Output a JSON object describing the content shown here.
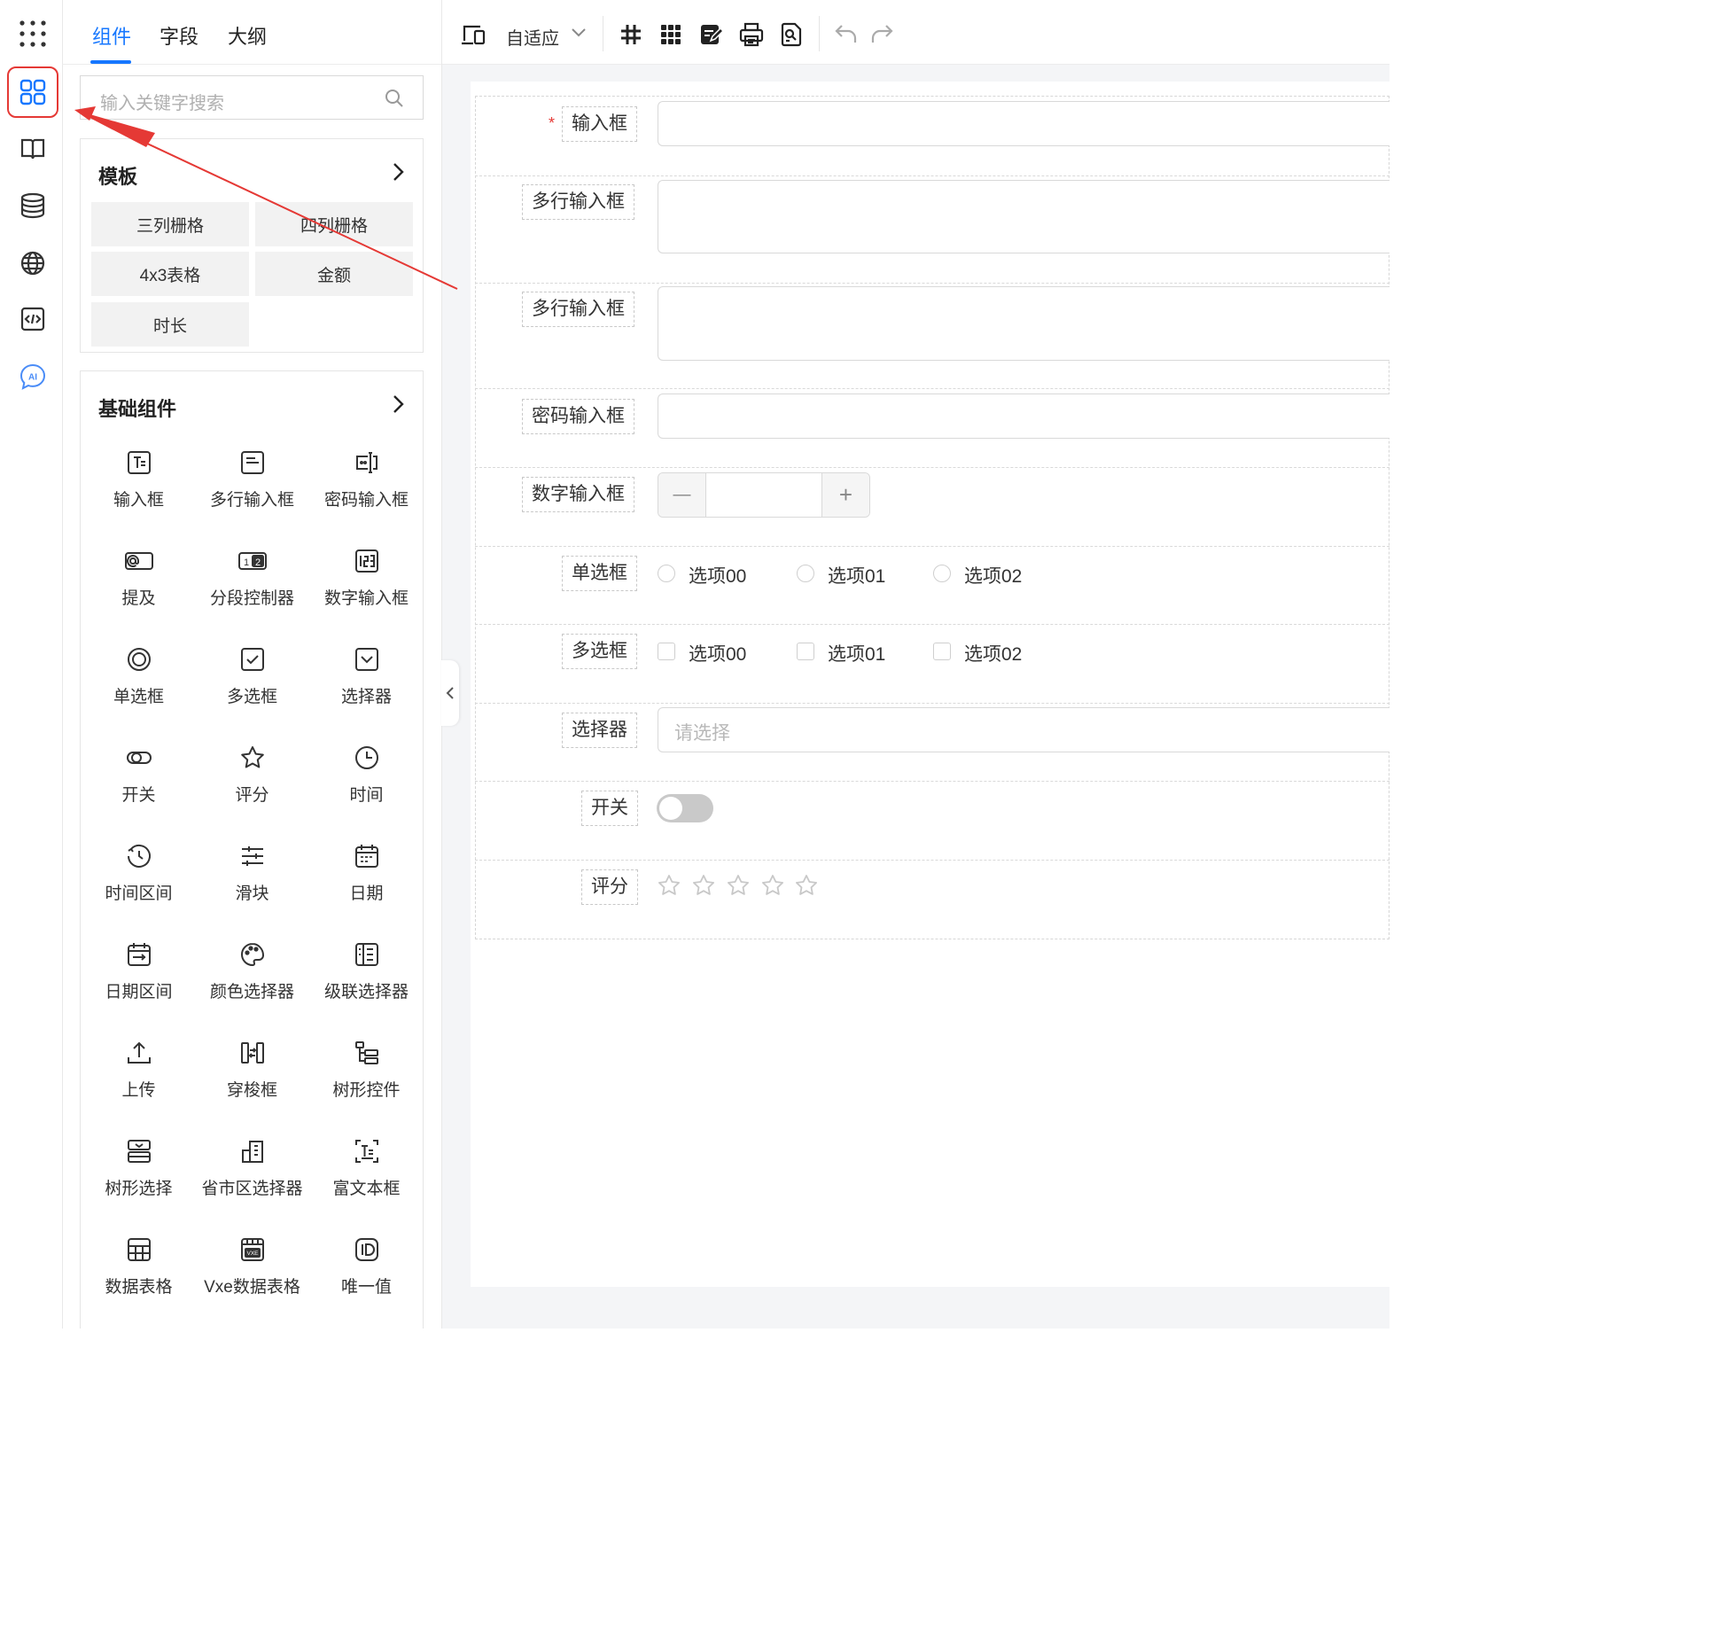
{
  "rail": {
    "icons": [
      "apps-grid-icon",
      "components-icon",
      "book-icon",
      "database-icon",
      "globe-icon",
      "code-icon",
      "ai-icon"
    ]
  },
  "left_tabs": [
    {
      "label": "组件",
      "active": true
    },
    {
      "label": "字段",
      "active": false
    },
    {
      "label": "大纲",
      "active": false
    }
  ],
  "search": {
    "placeholder": "输入关键字搜索"
  },
  "templates": {
    "title": "模板",
    "items": [
      "三列栅格",
      "四列栅格",
      "4x3表格",
      "金额",
      "时长"
    ]
  },
  "basic": {
    "title": "基础组件",
    "items": [
      {
        "label": "输入框",
        "icon": "text-input-icon"
      },
      {
        "label": "多行输入框",
        "icon": "textarea-icon"
      },
      {
        "label": "密码输入框",
        "icon": "password-icon"
      },
      {
        "label": "提及",
        "icon": "mention-icon"
      },
      {
        "label": "分段控制器",
        "icon": "segmented-icon"
      },
      {
        "label": "数字输入框",
        "icon": "number-input-icon"
      },
      {
        "label": "单选框",
        "icon": "radio-icon"
      },
      {
        "label": "多选框",
        "icon": "checkbox-icon"
      },
      {
        "label": "选择器",
        "icon": "select-icon"
      },
      {
        "label": "开关",
        "icon": "switch-icon"
      },
      {
        "label": "评分",
        "icon": "star-icon"
      },
      {
        "label": "时间",
        "icon": "clock-icon"
      },
      {
        "label": "时间区间",
        "icon": "time-range-icon"
      },
      {
        "label": "滑块",
        "icon": "slider-icon"
      },
      {
        "label": "日期",
        "icon": "calendar-icon"
      },
      {
        "label": "日期区间",
        "icon": "date-range-icon"
      },
      {
        "label": "颜色选择器",
        "icon": "palette-icon"
      },
      {
        "label": "级联选择器",
        "icon": "cascader-icon"
      },
      {
        "label": "上传",
        "icon": "upload-icon"
      },
      {
        "label": "穿梭框",
        "icon": "transfer-icon"
      },
      {
        "label": "树形控件",
        "icon": "tree-icon"
      },
      {
        "label": "树形选择",
        "icon": "tree-select-icon"
      },
      {
        "label": "省市区选择器",
        "icon": "region-icon"
      },
      {
        "label": "富文本框",
        "icon": "rich-text-icon"
      },
      {
        "label": "数据表格",
        "icon": "table-icon"
      },
      {
        "label": "Vxe数据表格",
        "icon": "vxe-table-icon"
      },
      {
        "label": "唯一值",
        "icon": "id-icon"
      }
    ]
  },
  "toolbar": {
    "device_label": "自适应",
    "icons": [
      "device-icon",
      "grid-hash-icon",
      "grid-dots-icon",
      "edit-icon",
      "print-icon",
      "preview-icon",
      "undo-icon",
      "redo-icon"
    ]
  },
  "form": {
    "fields": [
      {
        "label": "输入框",
        "required": true
      },
      {
        "label": "多行输入框"
      },
      {
        "label": "多行输入框"
      },
      {
        "label": "密码输入框"
      },
      {
        "label": "数字输入框"
      },
      {
        "label": "单选框",
        "options": [
          "选项00",
          "选项01",
          "选项02"
        ]
      },
      {
        "label": "多选框",
        "options": [
          "选项00",
          "选项01",
          "选项02"
        ]
      },
      {
        "label": "选择器",
        "placeholder": "请选择"
      },
      {
        "label": "开关"
      },
      {
        "label": "评分",
        "stars": 5
      }
    ],
    "required_mark": "*",
    "stepper_minus": "—",
    "stepper_plus": "+"
  },
  "colors": {
    "accent": "#1677ff",
    "highlight": "#e53935"
  }
}
